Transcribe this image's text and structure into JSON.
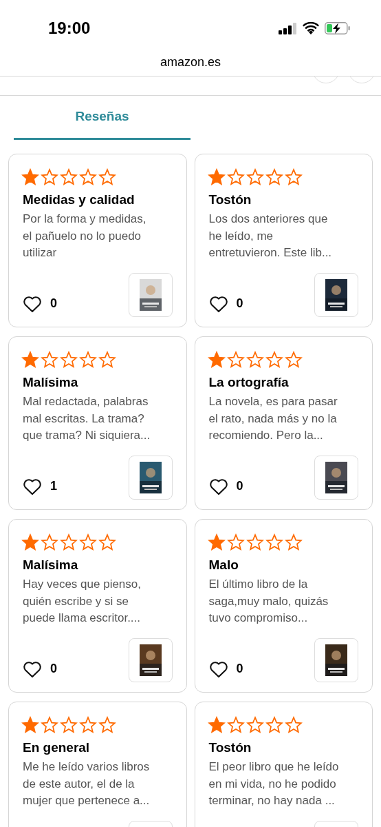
{
  "status_bar": {
    "time": "19:00"
  },
  "browser": {
    "url": "amazon.es"
  },
  "tabs": [
    {
      "label": "Reseñas",
      "selected": true
    }
  ],
  "reviews": [
    {
      "stars": 1,
      "title": "Medidas y calidad",
      "text": "Por la forma y medidas,\nel pañuelo no lo puedo\nutilizar",
      "likes": "0"
    },
    {
      "stars": 1,
      "title": "Tostón",
      "text": "Los dos anteriores que\nhe leído, me\nentretuvieron. Este lib...",
      "likes": "0"
    },
    {
      "stars": 1,
      "title": "Malísima",
      "text": "Mal redactada, palabras\nmal escritas. La trama?\nque trama? Ni siquiera...",
      "likes": "1"
    },
    {
      "stars": 1,
      "title": "La ortografía",
      "text": "La novela, es para pasar\nel rato, nada más y no la\nrecomiendo. Pero la...",
      "likes": "0"
    },
    {
      "stars": 1,
      "title": "Malísima",
      "text": "Hay veces que pienso,\nquién escribe y si se\npuede llama escritor....",
      "likes": "0"
    },
    {
      "stars": 1,
      "title": "Malo",
      "text": "El último libro de la\nsaga,muy malo, quizás\ntuvo compromiso...",
      "likes": "0"
    },
    {
      "stars": 1,
      "title": "En general",
      "text": "Me he leído varios libros\nde este autor, el de la\nmujer que pertenece a..."
    },
    {
      "stars": 1,
      "title": "Tostón",
      "text": "El peor libro que he leído\nen mi vida, no he podido\nterminar, no hay nada ..."
    }
  ]
}
